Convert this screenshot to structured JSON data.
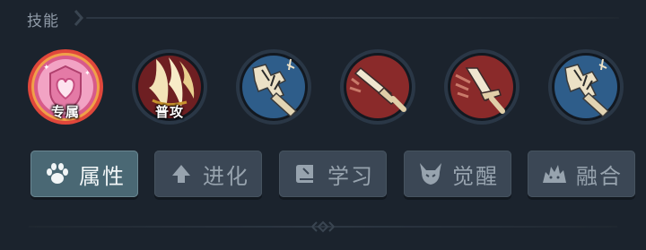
{
  "section": {
    "title": "技能"
  },
  "skills": [
    {
      "id": "exclusive",
      "label": "专属",
      "icon": "heart-shield-icon",
      "rim": "#e0473b",
      "bg": "#e88bb0"
    },
    {
      "id": "basic-attack",
      "label": "普攻",
      "icon": "flame-slash-icon",
      "rim": "#23303e",
      "bg": "#7a2326"
    },
    {
      "id": "skill-3",
      "label": "",
      "icon": "cracked-hammer-icon",
      "rim": "#23303e",
      "bg": "#2e5d8a"
    },
    {
      "id": "skill-4",
      "label": "",
      "icon": "sword-thrust-icon",
      "rim": "#23303e",
      "bg": "#8a2a2a"
    },
    {
      "id": "skill-5",
      "label": "",
      "icon": "sword-dash-icon",
      "rim": "#23303e",
      "bg": "#8a2a2a"
    },
    {
      "id": "skill-6",
      "label": "",
      "icon": "cracked-hammer-icon",
      "rim": "#23303e",
      "bg": "#2e5d8a"
    }
  ],
  "tabs": [
    {
      "id": "attributes",
      "label": "属性",
      "icon": "paw-icon",
      "active": true
    },
    {
      "id": "evolve",
      "label": "进化",
      "icon": "up-arrow-icon",
      "active": false
    },
    {
      "id": "learn",
      "label": "学习",
      "icon": "book-icon",
      "active": false
    },
    {
      "id": "awaken",
      "label": "觉醒",
      "icon": "horned-demon-icon",
      "active": false
    },
    {
      "id": "fuse",
      "label": "融合",
      "icon": "fusion-creature-icon",
      "active": false
    }
  ],
  "colors": {
    "background": "#1b232d",
    "tab_active": "#4a6874",
    "tab_inactive": "#3b4755",
    "exclusive_rim": "#e0473b"
  }
}
